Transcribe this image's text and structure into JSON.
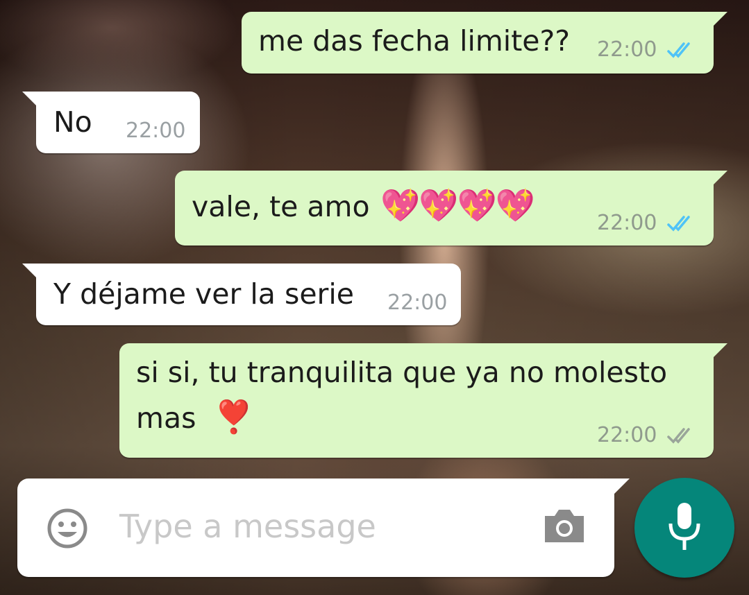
{
  "conversation": {
    "messages": [
      {
        "direction": "outgoing",
        "text": "me das fecha limite??",
        "time": "22:00",
        "status": "read"
      },
      {
        "direction": "incoming",
        "text": "No",
        "time": "22:00"
      },
      {
        "direction": "outgoing",
        "text": "vale, te amo",
        "emoji": "💖💖💖💖",
        "emoji_name": "sparkling-heart",
        "time": "22:00",
        "status": "read"
      },
      {
        "direction": "incoming",
        "text": "Y déjame ver la serie",
        "time": "22:00"
      },
      {
        "direction": "outgoing",
        "text_line1": "si si, tu tranquilita que ya no molesto",
        "text_line2": "mas",
        "emoji": "❣️",
        "emoji_name": "heart-exclamation",
        "time": "22:00",
        "status": "delivered"
      }
    ]
  },
  "composer": {
    "placeholder": "Type a message",
    "emoji_icon": "smiley-face-icon",
    "camera_icon": "camera-icon",
    "mic_icon": "microphone-icon"
  },
  "colors": {
    "outgoing_bubble": "#dcf8c6",
    "incoming_bubble": "#ffffff",
    "read_ticks": "#4fc3f7",
    "delivered_ticks": "#9aa59a",
    "mic_button": "#05867a"
  }
}
